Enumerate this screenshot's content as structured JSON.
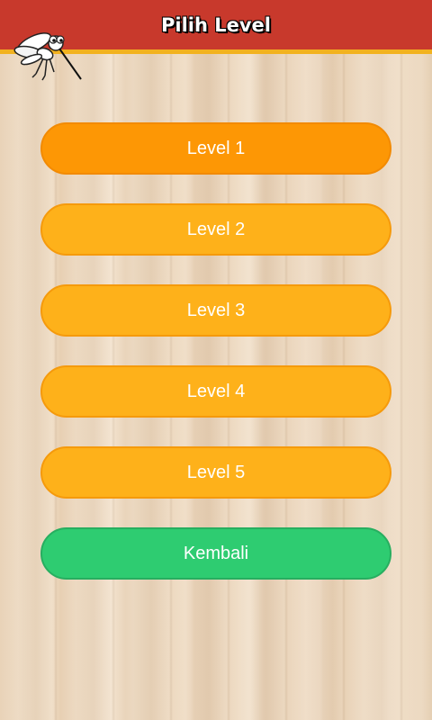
{
  "header": {
    "title": "Pilih Level",
    "logo_icon": "mosquito-icon",
    "bar_color": "#c8392c",
    "accent_color": "#f2b21f"
  },
  "levels": [
    {
      "label": "Level 1",
      "state": "pressed",
      "color": "#fd9705"
    },
    {
      "label": "Level 2",
      "state": "normal",
      "color": "#feb11a"
    },
    {
      "label": "Level 3",
      "state": "normal",
      "color": "#feb11a"
    },
    {
      "label": "Level 4",
      "state": "normal",
      "color": "#feb11a"
    },
    {
      "label": "Level 5",
      "state": "normal",
      "color": "#feb11a"
    }
  ],
  "back_button": {
    "label": "Kembali",
    "color": "#2ecc71"
  }
}
